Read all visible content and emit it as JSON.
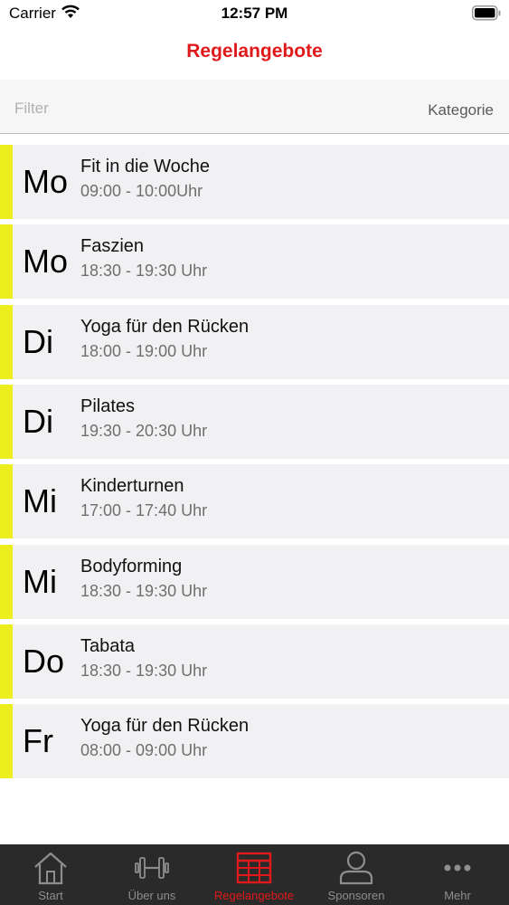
{
  "status_bar": {
    "carrier": "Carrier",
    "time": "12:57 PM"
  },
  "nav": {
    "title": "Regelangebote"
  },
  "filter": {
    "placeholder": "Filter",
    "value": "",
    "category_label": "Kategorie"
  },
  "rows": [
    {
      "day": "Mo",
      "title": "Fit in die Woche",
      "time": "09:00 - 10:00Uhr"
    },
    {
      "day": "Mo",
      "title": "Faszien",
      "time": "18:30 - 19:30 Uhr"
    },
    {
      "day": "Di",
      "title": "Yoga für den Rücken",
      "time": "18:00 - 19:00 Uhr"
    },
    {
      "day": "Di",
      "title": "Pilates",
      "time": "19:30 - 20:30 Uhr"
    },
    {
      "day": "Mi",
      "title": "Kinderturnen",
      "time": "17:00 - 17:40 Uhr"
    },
    {
      "day": "Mi",
      "title": "Bodyforming",
      "time": "18:30 - 19:30 Uhr"
    },
    {
      "day": "Do",
      "title": "Tabata",
      "time": "18:30 - 19:30 Uhr"
    },
    {
      "day": "Fr",
      "title": "Yoga für den Rücken",
      "time": "08:00 - 09:00 Uhr"
    }
  ],
  "tabs": [
    {
      "label": "Start",
      "icon": "home-icon"
    },
    {
      "label": "Über uns",
      "icon": "dumbbell-icon"
    },
    {
      "label": "Regelangebote",
      "icon": "table-icon",
      "active": true
    },
    {
      "label": "Sponsoren",
      "icon": "person-icon"
    },
    {
      "label": "Mehr",
      "icon": "more-icon"
    }
  ],
  "colors": {
    "accent": "#e0191b",
    "row_marker": "#ecef1d",
    "tab_bar": "#2a2a2a"
  }
}
